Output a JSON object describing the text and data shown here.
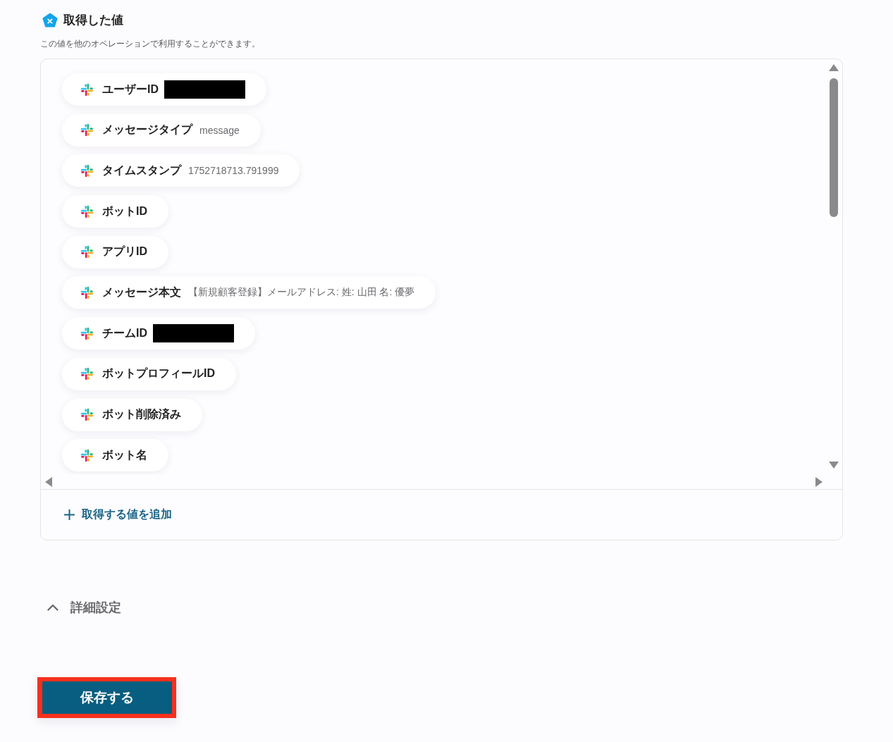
{
  "section": {
    "title": "取得した値",
    "description": "この値を他のオペレーションで利用することができます。"
  },
  "values": [
    {
      "label": "ユーザーID",
      "redacted": true
    },
    {
      "label": "メッセージタイプ",
      "value": "message",
      "redacted": false
    },
    {
      "label": "タイムスタンプ",
      "value": "1752718713.791999",
      "redacted": false
    },
    {
      "label": "ボットID",
      "redacted": false
    },
    {
      "label": "アプリID",
      "redacted": false
    },
    {
      "label": "メッセージ本文",
      "value": "【新規顧客登録】メールアドレス: 姓: 山田 名: 優夢",
      "redacted": false
    },
    {
      "label": "チームID",
      "redacted": true
    },
    {
      "label": "ボットプロフィールID",
      "redacted": false
    },
    {
      "label": "ボット削除済み",
      "redacted": false
    },
    {
      "label": "ボット名",
      "redacted": false
    }
  ],
  "add_value_link": {
    "label": "取得する値を追加"
  },
  "advanced_settings": {
    "label": "詳細設定"
  },
  "save_button": {
    "label": "保存する",
    "highlighted": true
  }
}
